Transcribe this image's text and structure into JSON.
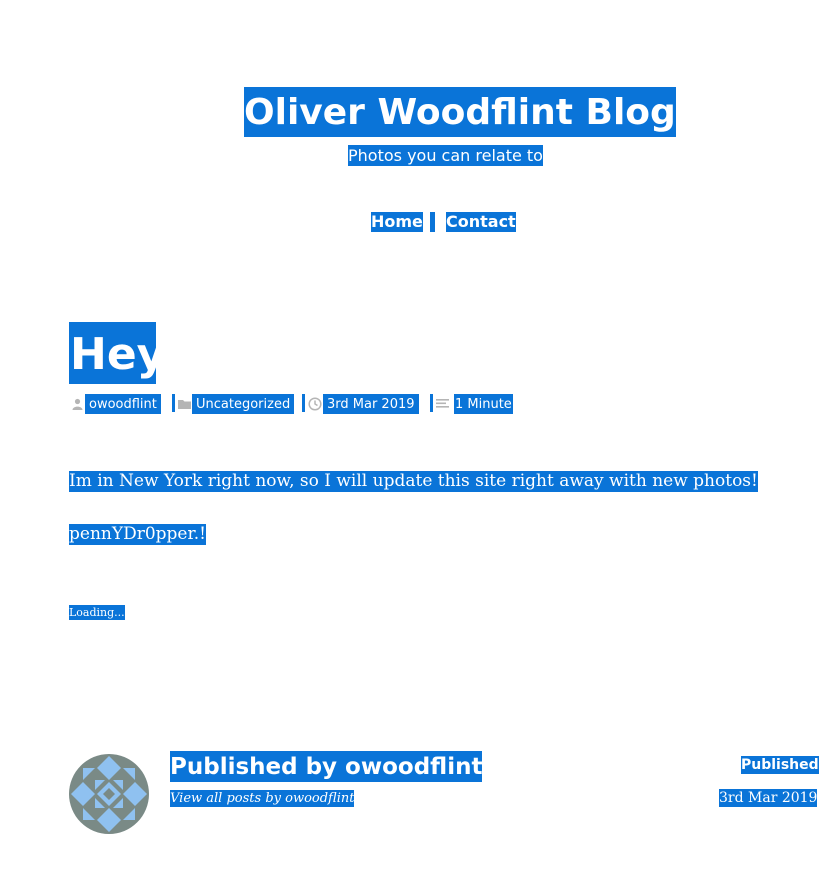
{
  "site": {
    "title": "Oliver Woodflint Blog",
    "description": "Photos you can relate to"
  },
  "nav": {
    "items": [
      "Home",
      "Contact"
    ]
  },
  "post": {
    "title": "Hey",
    "meta": {
      "author": "owoodflint",
      "category": "Uncategorized",
      "date": "3rd Mar 2019",
      "read_time": "1 Minute"
    },
    "paragraphs": [
      "Im in New York right now, so I will update this site right away with new photos!",
      "pennYDr0pper.!"
    ],
    "loading_text": "Loading..."
  },
  "author_box": {
    "name": "Published by owoodflint",
    "view_all": "View all posts by owoodflint"
  },
  "published": {
    "label": "Published",
    "date": "3rd Mar 2019"
  },
  "colors": {
    "highlight": "#0a74d8",
    "icon_gray": "#b5b5b5",
    "avatar_blue": "#8fc1f0",
    "avatar_gray": "#7a8a86"
  },
  "icons": [
    "user-icon",
    "folder-icon",
    "clock-icon",
    "reading-time-icon",
    "identicon-avatar"
  ]
}
